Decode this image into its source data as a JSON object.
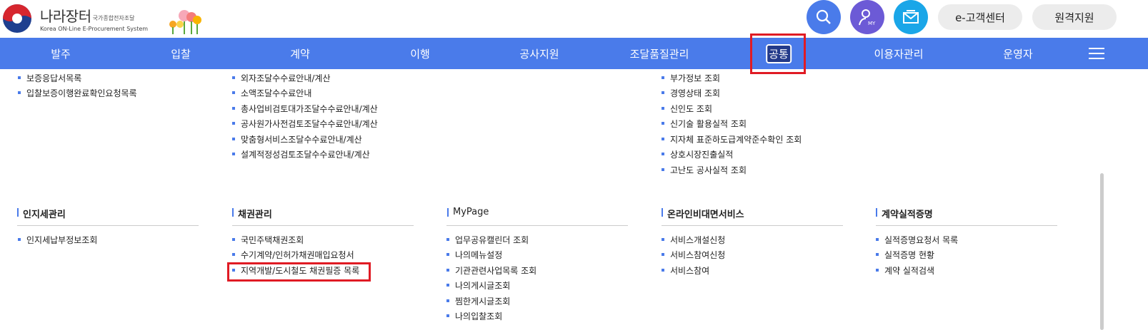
{
  "header": {
    "logo_main": "나라장터",
    "logo_sub": "국가종합전자조달",
    "logo_eng": "Korea ON-Line E-Procurement System",
    "search_icon": "search-icon",
    "my_icon": "user-my-icon",
    "my_label": "MY",
    "mail_icon": "mail-icon",
    "customer_center": "e-고객센터",
    "remote_support": "원격지원"
  },
  "nav": {
    "items": [
      "발주",
      "입찰",
      "계약",
      "이행",
      "공사지원",
      "조달품질관리",
      "공통",
      "이용자관리",
      "운영자"
    ],
    "active": "공통",
    "menu_icon": "hamburger-menu-icon"
  },
  "top_lists": {
    "col1": [
      "보증응답서목록",
      "입찰보증이행완료확인요청목록"
    ],
    "col2": [
      "외자조달수수료안내/계산",
      "소액조달수수료안내",
      "총사업비검토대가조달수수료안내/계산",
      "공사원가사전검토조달수수료안내/계산",
      "맞춤형서비스조달수수료안내/계산",
      "설계적정성검토조달수수료안내/계산"
    ],
    "col4": [
      "부가정보 조회",
      "경영상태 조회",
      "신인도 조회",
      "신기술 활용실적 조회",
      "지자체 표준하도급계약준수확인 조회",
      "상호시장진출실적",
      "고난도 공사실적 조회"
    ]
  },
  "sections": [
    {
      "title": "인지세관리",
      "items": [
        "인지세납부정보조회"
      ]
    },
    {
      "title": "채권관리",
      "items": [
        "국민주택채권조회",
        "수기계약/인허가채권매입요청서",
        "지역개발/도시철도 채권필증 목록"
      ]
    },
    {
      "title": "MyPage",
      "items": [
        "업무공유캘린더 조회",
        "나의메뉴설정",
        "기관관련사업목록 조회",
        "나의게시글조회",
        "찜한게시글조회",
        "나의입찰조회"
      ]
    },
    {
      "title": "온라인비대면서비스",
      "items": [
        "서비스개설신청",
        "서비스참여신청",
        "서비스참여"
      ]
    },
    {
      "title": "계약실적증명",
      "items": [
        "실적증명요청서 목록",
        "실적증명 현황",
        "계약 실적검색"
      ]
    }
  ],
  "colors": {
    "nav_bg": "#4a7bea",
    "highlight": "#e01b24",
    "bullet": "#4a7bea"
  }
}
